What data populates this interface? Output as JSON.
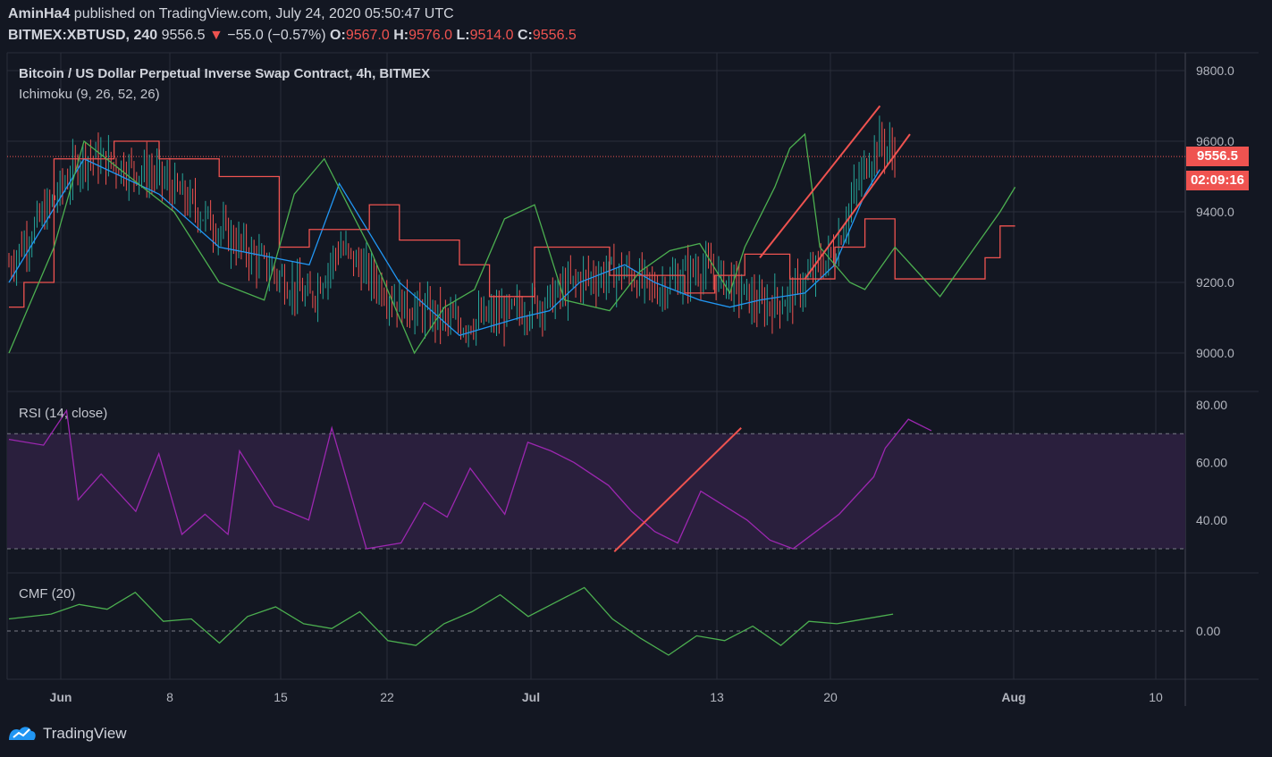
{
  "header": {
    "user": "AminHa4",
    "published": " published on TradingView.com, July 24, 2020 05:50:47 UTC",
    "symbol": "BITMEX:XBTUSD, 240",
    "last": "9556.5",
    "change": "−55.0 (−0.57%)",
    "o_label": "O:",
    "o": "9567.0",
    "h_label": "H:",
    "h": "9576.0",
    "l_label": "L:",
    "l": "9514.0",
    "c_label": "C:",
    "c": "9556.5"
  },
  "chart_data": [
    {
      "type": "candlestick",
      "title": "Bitcoin / US Dollar Perpetual Inverse Swap Contract, 4h, BITMEX",
      "indicator": "Ichimoku (9, 26, 52, 26)",
      "y_ticks": [
        9800,
        9600,
        9400,
        9200,
        9000
      ],
      "y_tick_labels": [
        "9800.0",
        "9600.0",
        "9400.0",
        "9200.0",
        "9000.0"
      ],
      "last_price": 9556.5,
      "last_price_label": "9556.5",
      "countdown_label": "02:09:16",
      "x_tick_labels": [
        "Jun",
        "8",
        "15",
        "22",
        "Jul",
        "13",
        "20",
        "Aug",
        "10"
      ],
      "close_path": [
        [
          0,
          9250
        ],
        [
          5,
          9560
        ],
        [
          10,
          9500
        ],
        [
          14,
          9350
        ],
        [
          20,
          9150
        ],
        [
          22,
          9300
        ],
        [
          26,
          9140
        ],
        [
          30,
          9080
        ],
        [
          34,
          9120
        ],
        [
          36,
          9150
        ],
        [
          38,
          9210
        ],
        [
          41,
          9230
        ],
        [
          43,
          9180
        ],
        [
          46,
          9240
        ],
        [
          48,
          9200
        ],
        [
          50,
          9130
        ],
        [
          52,
          9160
        ],
        [
          53,
          9200
        ],
        [
          55,
          9290
        ],
        [
          56,
          9420
        ],
        [
          57,
          9530
        ],
        [
          58,
          9600
        ],
        [
          59,
          9560
        ]
      ],
      "tenkan_path": [
        [
          0,
          9200
        ],
        [
          5,
          9550
        ],
        [
          10,
          9450
        ],
        [
          14,
          9300
        ],
        [
          20,
          9250
        ],
        [
          22,
          9480
        ],
        [
          26,
          9200
        ],
        [
          30,
          9050
        ],
        [
          34,
          9100
        ],
        [
          36,
          9120
        ],
        [
          38,
          9200
        ],
        [
          41,
          9250
        ],
        [
          43,
          9200
        ],
        [
          46,
          9150
        ],
        [
          48,
          9130
        ],
        [
          50,
          9150
        ],
        [
          53,
          9170
        ],
        [
          55,
          9250
        ],
        [
          57,
          9450
        ],
        [
          58,
          9520
        ]
      ],
      "kijun_path": [
        [
          0,
          9130
        ],
        [
          1,
          9130
        ],
        [
          1,
          9200
        ],
        [
          3,
          9200
        ],
        [
          3,
          9550
        ],
        [
          7,
          9550
        ],
        [
          7,
          9600
        ],
        [
          10,
          9600
        ],
        [
          10,
          9550
        ],
        [
          14,
          9550
        ],
        [
          14,
          9500
        ],
        [
          18,
          9500
        ],
        [
          18,
          9300
        ],
        [
          20,
          9300
        ],
        [
          20,
          9350
        ],
        [
          24,
          9350
        ],
        [
          24,
          9420
        ],
        [
          26,
          9420
        ],
        [
          26,
          9320
        ],
        [
          30,
          9320
        ],
        [
          30,
          9250
        ],
        [
          32,
          9250
        ],
        [
          32,
          9160
        ],
        [
          35,
          9160
        ],
        [
          35,
          9300
        ],
        [
          40,
          9300
        ],
        [
          40,
          9220
        ],
        [
          45,
          9220
        ],
        [
          45,
          9170
        ],
        [
          47,
          9170
        ],
        [
          47,
          9220
        ],
        [
          49,
          9220
        ],
        [
          49,
          9280
        ],
        [
          52,
          9280
        ],
        [
          52,
          9210
        ],
        [
          55,
          9210
        ],
        [
          55,
          9300
        ],
        [
          57,
          9300
        ],
        [
          57,
          9380
        ],
        [
          59,
          9380
        ],
        [
          59,
          9210
        ],
        [
          65,
          9210
        ],
        [
          65,
          9270
        ],
        [
          66,
          9270
        ],
        [
          66,
          9360
        ],
        [
          67,
          9360
        ]
      ],
      "chikou_path": [
        [
          0,
          9000
        ],
        [
          3,
          9300
        ],
        [
          5,
          9600
        ],
        [
          8,
          9500
        ],
        [
          11,
          9400
        ],
        [
          14,
          9200
        ],
        [
          17,
          9150
        ],
        [
          19,
          9450
        ],
        [
          21,
          9550
        ],
        [
          24,
          9300
        ],
        [
          27,
          9000
        ],
        [
          29,
          9130
        ],
        [
          31,
          9180
        ],
        [
          33,
          9380
        ],
        [
          35,
          9420
        ],
        [
          37,
          9150
        ],
        [
          40,
          9120
        ],
        [
          42,
          9230
        ],
        [
          44,
          9290
        ],
        [
          46,
          9310
        ],
        [
          48,
          9170
        ],
        [
          49,
          9300
        ],
        [
          51,
          9470
        ],
        [
          52,
          9580
        ],
        [
          53,
          9620
        ],
        [
          54,
          9300
        ],
        [
          56,
          9200
        ],
        [
          57,
          9180
        ],
        [
          59,
          9300
        ],
        [
          62,
          9160
        ],
        [
          64,
          9280
        ],
        [
          66,
          9400
        ],
        [
          67,
          9470
        ]
      ],
      "trendlines": [
        [
          [
            50,
            9270
          ],
          [
            58,
            9700
          ]
        ],
        [
          [
            53,
            9210
          ],
          [
            60,
            9620
          ]
        ]
      ]
    },
    {
      "type": "line",
      "title": "RSI (14, close)",
      "y_ticks": [
        80,
        60,
        40
      ],
      "y_tick_labels": [
        "80.00",
        "60.00",
        "40.00"
      ],
      "band": [
        30,
        70
      ],
      "path": [
        [
          0,
          68
        ],
        [
          3,
          66
        ],
        [
          5,
          78
        ],
        [
          6,
          47
        ],
        [
          8,
          56
        ],
        [
          11,
          43
        ],
        [
          13,
          63
        ],
        [
          15,
          35
        ],
        [
          17,
          42
        ],
        [
          19,
          35
        ],
        [
          20,
          64
        ],
        [
          23,
          45
        ],
        [
          26,
          40
        ],
        [
          28,
          72
        ],
        [
          31,
          30
        ],
        [
          34,
          32
        ],
        [
          36,
          46
        ],
        [
          38,
          41
        ],
        [
          40,
          58
        ],
        [
          43,
          42
        ],
        [
          45,
          67
        ],
        [
          47,
          64
        ],
        [
          49,
          60
        ],
        [
          52,
          52
        ],
        [
          54,
          43
        ],
        [
          56,
          36
        ],
        [
          58,
          32
        ],
        [
          60,
          50
        ],
        [
          62,
          45
        ],
        [
          64,
          40
        ],
        [
          66,
          33
        ],
        [
          68,
          30
        ],
        [
          70,
          36
        ],
        [
          72,
          42
        ],
        [
          75,
          55
        ],
        [
          76,
          65
        ],
        [
          78,
          75
        ],
        [
          80,
          71
        ]
      ],
      "trendline": [
        [
          52.5,
          29
        ],
        [
          63.5,
          72
        ]
      ]
    },
    {
      "type": "line",
      "title": "CMF (20)",
      "y_ticks": [
        0
      ],
      "y_tick_labels": [
        "0.00"
      ],
      "path": [
        [
          0,
          0.05
        ],
        [
          3,
          0.07
        ],
        [
          5,
          0.11
        ],
        [
          7,
          0.09
        ],
        [
          9,
          0.16
        ],
        [
          11,
          0.04
        ],
        [
          13,
          0.05
        ],
        [
          15,
          -0.05
        ],
        [
          17,
          0.06
        ],
        [
          19,
          0.1
        ],
        [
          21,
          0.03
        ],
        [
          23,
          0.01
        ],
        [
          25,
          0.08
        ],
        [
          27,
          -0.04
        ],
        [
          29,
          -0.06
        ],
        [
          31,
          0.03
        ],
        [
          33,
          0.08
        ],
        [
          35,
          0.15
        ],
        [
          37,
          0.06
        ],
        [
          39,
          0.12
        ],
        [
          41,
          0.18
        ],
        [
          43,
          0.05
        ],
        [
          45,
          -0.03
        ],
        [
          47,
          -0.1
        ],
        [
          49,
          -0.02
        ],
        [
          51,
          -0.04
        ],
        [
          53,
          0.02
        ],
        [
          55,
          -0.06
        ],
        [
          57,
          0.04
        ],
        [
          59,
          0.03
        ],
        [
          60,
          0.04
        ],
        [
          62,
          0.06
        ],
        [
          63,
          0.07
        ]
      ]
    }
  ],
  "brand": {
    "logo_name": "TradingView"
  },
  "colors": {
    "bg": "#131722",
    "red": "#ef5350",
    "blue": "#2196f3",
    "green": "#4caf50",
    "rsi": "#9c27b0",
    "grid": "#2a2e39"
  }
}
